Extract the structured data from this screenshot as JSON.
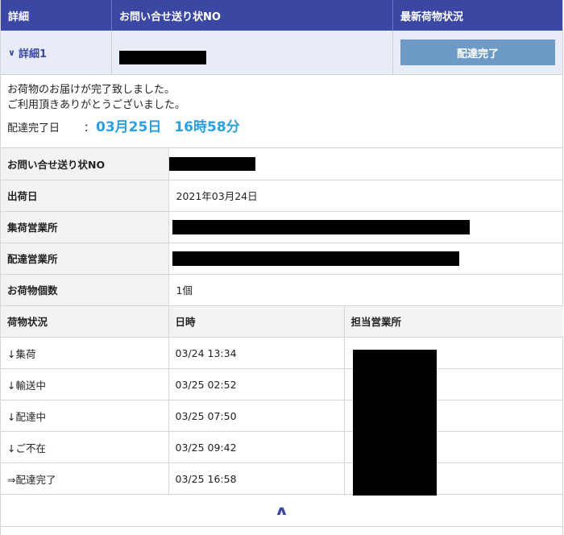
{
  "header": {
    "col1": "詳細",
    "col2": "お問い合せ送り状NO",
    "col3": "最新荷物状況"
  },
  "summary_row": {
    "detail_label": "詳細1",
    "status_button": "配達完了"
  },
  "message": {
    "line1": "お荷物のお届けが完了致しました。",
    "line2": "ご利用頂きありがとうございました。",
    "delivered_label": "配達完了日",
    "colon": "：",
    "date": "03月25日",
    "time": "16時58分"
  },
  "info": [
    {
      "label": "お問い合せ送り状NO",
      "value": ""
    },
    {
      "label": "出荷日",
      "value": "2021年03月24日"
    },
    {
      "label": "集荷営業所",
      "value": ""
    },
    {
      "label": "配達営業所",
      "value": ""
    },
    {
      "label": "お荷物個数",
      "value": "1個"
    }
  ],
  "history": {
    "headers": [
      "荷物状況",
      "日時",
      "担当営業所"
    ],
    "rows": [
      {
        "status": "↓集荷",
        "datetime": "03/24 13:34"
      },
      {
        "status": "↓輸送中",
        "datetime": "03/25 02:52"
      },
      {
        "status": "↓配達中",
        "datetime": "03/25 07:50"
      },
      {
        "status": "↓ご不在",
        "datetime": "03/25 09:42"
      },
      {
        "status": "⇒配達完了",
        "datetime": "03/25 16:58"
      }
    ]
  },
  "icons": {
    "expand": "chevron-down-icon",
    "collapse": "chevron-up-icon"
  },
  "colors": {
    "header_bg": "#3b48a3",
    "accent_text": "#2aa0e0",
    "status_button_bg": "#6d9bc5"
  }
}
